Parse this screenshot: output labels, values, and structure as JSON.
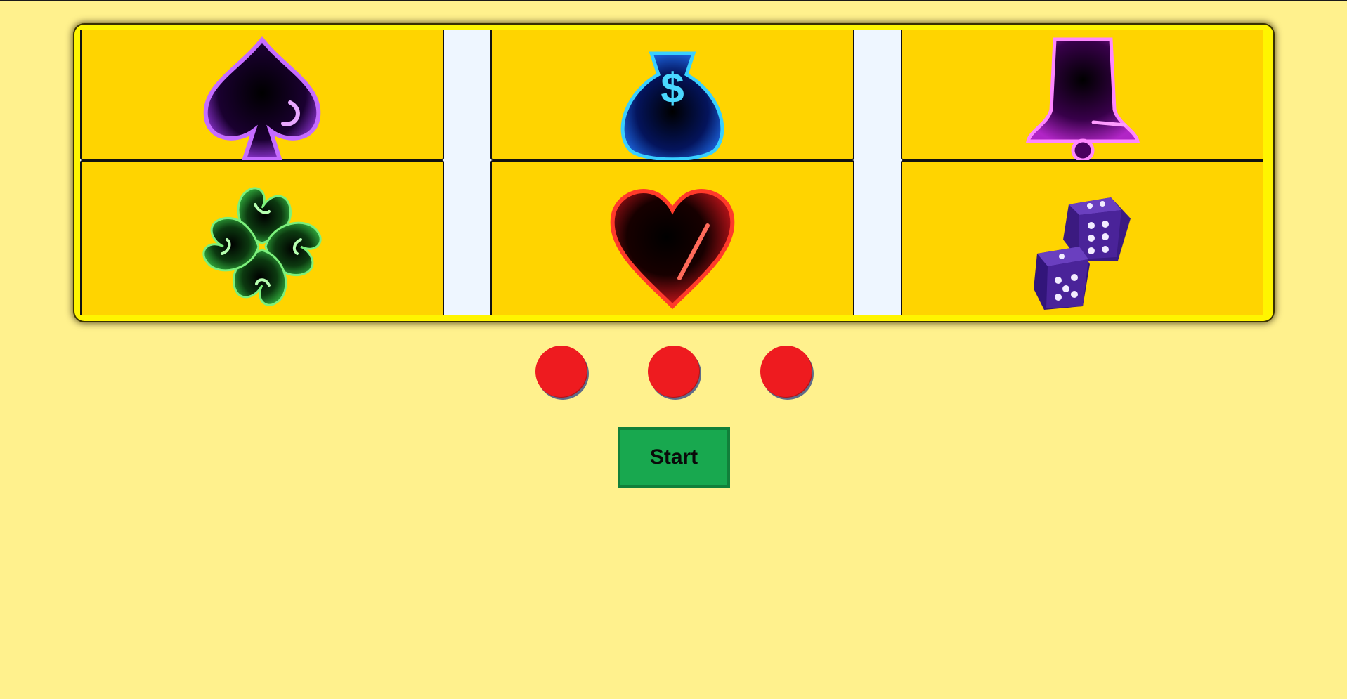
{
  "slot_machine": {
    "reels": [
      {
        "symbols": [
          "spade-icon",
          "clover-icon"
        ]
      },
      {
        "symbols": [
          "money-bag-icon",
          "heart-icon"
        ]
      },
      {
        "symbols": [
          "bell-icon",
          "dice-icon"
        ]
      }
    ],
    "lights": [
      {
        "color": "#ee1b1f"
      },
      {
        "color": "#ee1b1f"
      },
      {
        "color": "#ee1b1f"
      }
    ],
    "start_label": "Start",
    "money_bag_glyph": "$"
  },
  "colors": {
    "background": "#fff18d",
    "frame": "#fff500",
    "cell": "#ffd400",
    "reel_gap": "#eef6ff",
    "light": "#ee1b1f",
    "start_button": "#18a84f"
  }
}
